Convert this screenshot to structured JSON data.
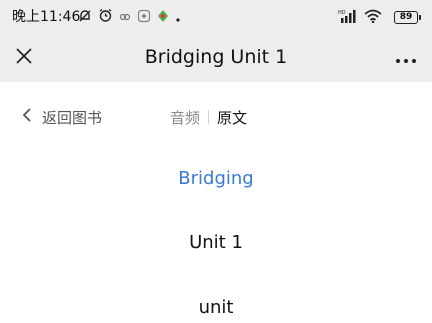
{
  "status_bar": {
    "time": "晚上11:46",
    "battery": "89"
  },
  "nav": {
    "title": "Bridging Unit 1"
  },
  "toolbar": {
    "back_label": "返回图书",
    "tab_audio": "音频",
    "tab_original": "原文"
  },
  "content": {
    "lines": [
      "Bridging",
      "Unit 1",
      "unit"
    ]
  },
  "colors": {
    "highlight": "#3a7bd5",
    "nav_bg": "#ededed"
  }
}
